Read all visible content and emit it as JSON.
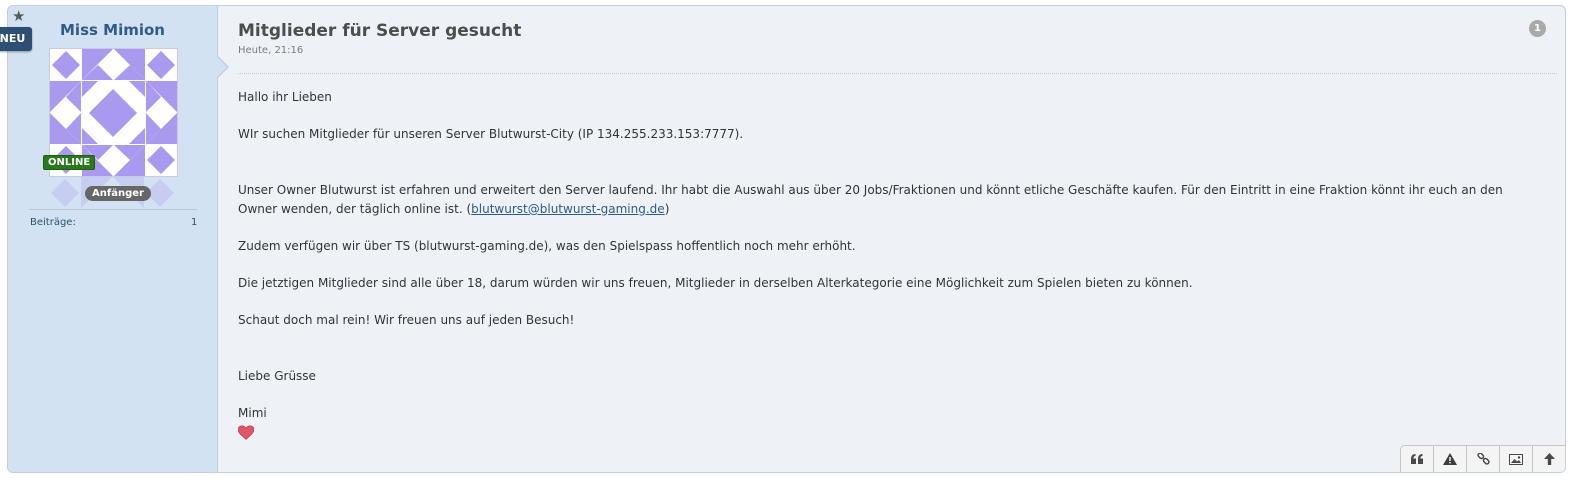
{
  "badges": {
    "new": "NEU",
    "online": "ONLINE"
  },
  "author": {
    "name": "Miss Mimion",
    "rank": "Anfänger",
    "stats_label": "Beiträge:",
    "stats_value": "1"
  },
  "post": {
    "title": "Mitglieder für Server gesucht",
    "date": "Heute, 21:16",
    "number": "1",
    "paragraphs": {
      "p1": "Hallo ihr Lieben",
      "p2": "WIr suchen Mitglieder für unseren Server Blutwurst-City (IP 134.255.233.153:7777).",
      "p3a": "Unser Owner Blutwurst ist erfahren und erweitert den Server laufend. Ihr habt die Auswahl aus über 20 Jobs/Fraktionen und könnt etliche Geschäfte kaufen. Für den Eintritt in eine Fraktion könnt ihr euch an den Owner wenden, der täglich online ist. (",
      "p3_link": "blutwurst@blutwurst-gaming.de",
      "p3b": ")",
      "p4": "Zudem verfügen wir über TS (blutwurst-gaming.de), was den Spielspass hoffentlich noch mehr erhöht.",
      "p5": "Die jetztigen Mitglieder sind alle über 18, darum würden wir uns freuen, Mitglieder in derselben Alterkategorie eine Möglichkeit zum Spielen bieten zu können.",
      "p6": "Schaut doch mal rein! Wir freuen uns auf jeden Besuch!",
      "p7": "Liebe Grüsse",
      "p8": "Mimi"
    }
  },
  "icons": {
    "star": "star-icon",
    "heart": "heart-icon",
    "quote": "quote-icon",
    "report": "warning-icon",
    "link": "link-icon",
    "image": "image-icon",
    "top": "arrow-up-icon"
  },
  "colors": {
    "sidebar": "#d3e2f2",
    "username": "#2e5b87",
    "online": "#2a7a1c",
    "identicon": "#a99af0"
  }
}
